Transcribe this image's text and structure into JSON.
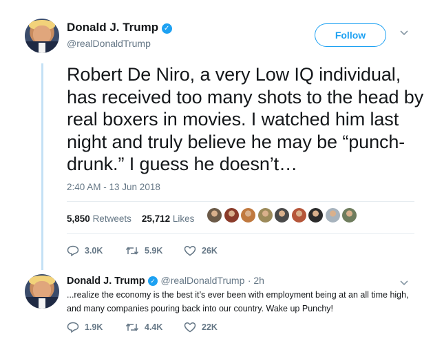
{
  "main_tweet": {
    "author_name": "Donald J. Trump",
    "handle": "@realDonaldTrump",
    "follow_label": "Follow",
    "text": "Robert De Niro, a very Low IQ individual, has received too many shots to the head by real boxers in movies. I watched him last night and truly believe he may be “punch-drunk.” I guess he doesn’t…",
    "timestamp": "2:40 AM - 13 Jun 2018",
    "retweets_count": "5,850",
    "retweets_label": "Retweets",
    "likes_count": "25,712",
    "likes_label": "Likes",
    "likers": [
      "#6b5a48",
      "#8a3b2a",
      "#c0793f",
      "#9c8a5a",
      "#4a4a4a",
      "#b5563a",
      "#2b2b2b",
      "#a7b3bd",
      "#6f7d5e"
    ],
    "replies": "3.0K",
    "retweets": "5.9K",
    "likes": "26K"
  },
  "reply_tweet": {
    "author_name": "Donald J. Trump",
    "handle": "@realDonaldTrump",
    "time": "· 2h",
    "text": "...realize the economy is the best it’s ever been with employment being at an all time high, and many companies pouring back into our country. Wake up Punchy!",
    "replies": "1.9K",
    "retweets": "4.4K",
    "likes": "22K"
  },
  "colors": {
    "accent": "#1da1f2",
    "muted": "#657786",
    "thread_line": "#c4e1f5"
  },
  "icons": [
    "verified-badge-icon",
    "chevron-down-icon",
    "reply-icon",
    "retweet-icon",
    "like-icon"
  ]
}
